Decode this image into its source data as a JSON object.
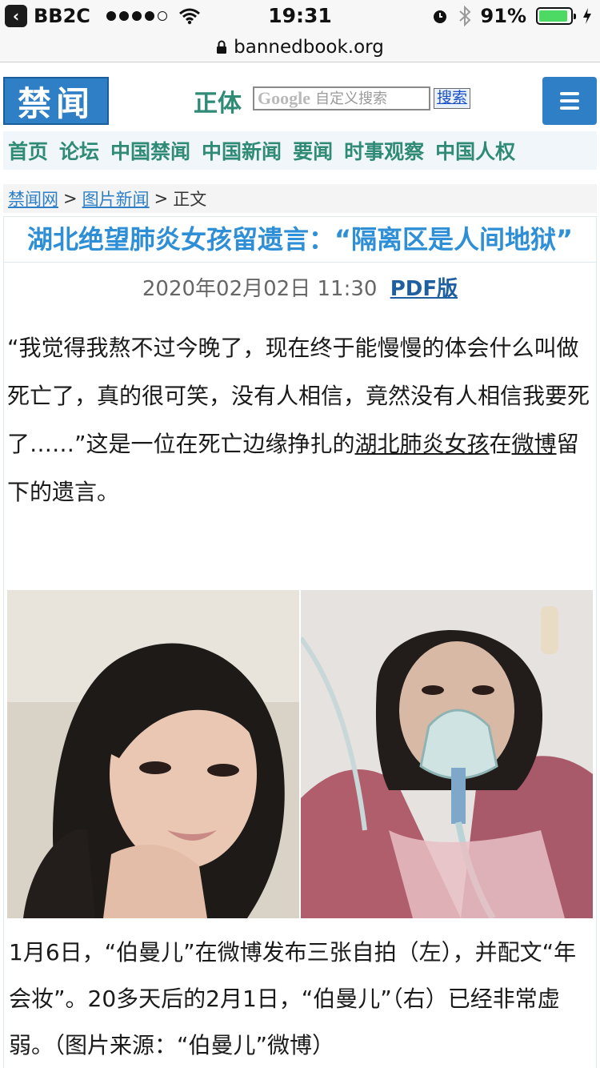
{
  "status_bar": {
    "back_label": "BB2C",
    "time": "19:31",
    "battery_percent": "91%",
    "battery_level": 0.91,
    "signal_bars_filled": 4,
    "signal_bars_total": 5
  },
  "address_bar": {
    "url": "bannedbook.org"
  },
  "header": {
    "logo_text": "禁闻",
    "script_switch": "正体",
    "search_brand": "Google",
    "search_placeholder": "自定义搜索",
    "search_button": "搜索"
  },
  "nav": {
    "items": [
      "首页",
      "论坛",
      "中国禁闻",
      "中国新闻",
      "要闻",
      "时事观察",
      "中国人权"
    ]
  },
  "breadcrumb": {
    "home": "禁闻网",
    "sep1": ">",
    "section": "图片新闻",
    "sep2": ">",
    "current": "正文"
  },
  "article": {
    "title": "湖北绝望肺炎女孩留遗言：“隔离区是人间地狱”",
    "date": "2020年02月02日 11:30",
    "pdf_label": "PDF版",
    "para_lead": "“我觉得我熬不过今晚了，现在终于能慢慢的体会什么叫做死亡了，真的很可笑，没有人相信，竟然没有人相信我要死了……”这是一位在死亡边缘挣扎的",
    "para_link1": "湖北肺炎女孩",
    "para_mid": "在",
    "para_link2": "微博",
    "para_tail": "留下的遗言。",
    "caption": "1月6日，“伯曼儿”在微博发布三张自拍（左），并配文“年会妆”。20多天后的2月1日，“伯曼儿”（右）已经非常虚弱。（图片来源：“伯曼儿”微博）"
  },
  "colors": {
    "brand_blue": "#2e7fc6",
    "nav_green": "#2f8a76",
    "title_blue": "#2e8fd6"
  }
}
